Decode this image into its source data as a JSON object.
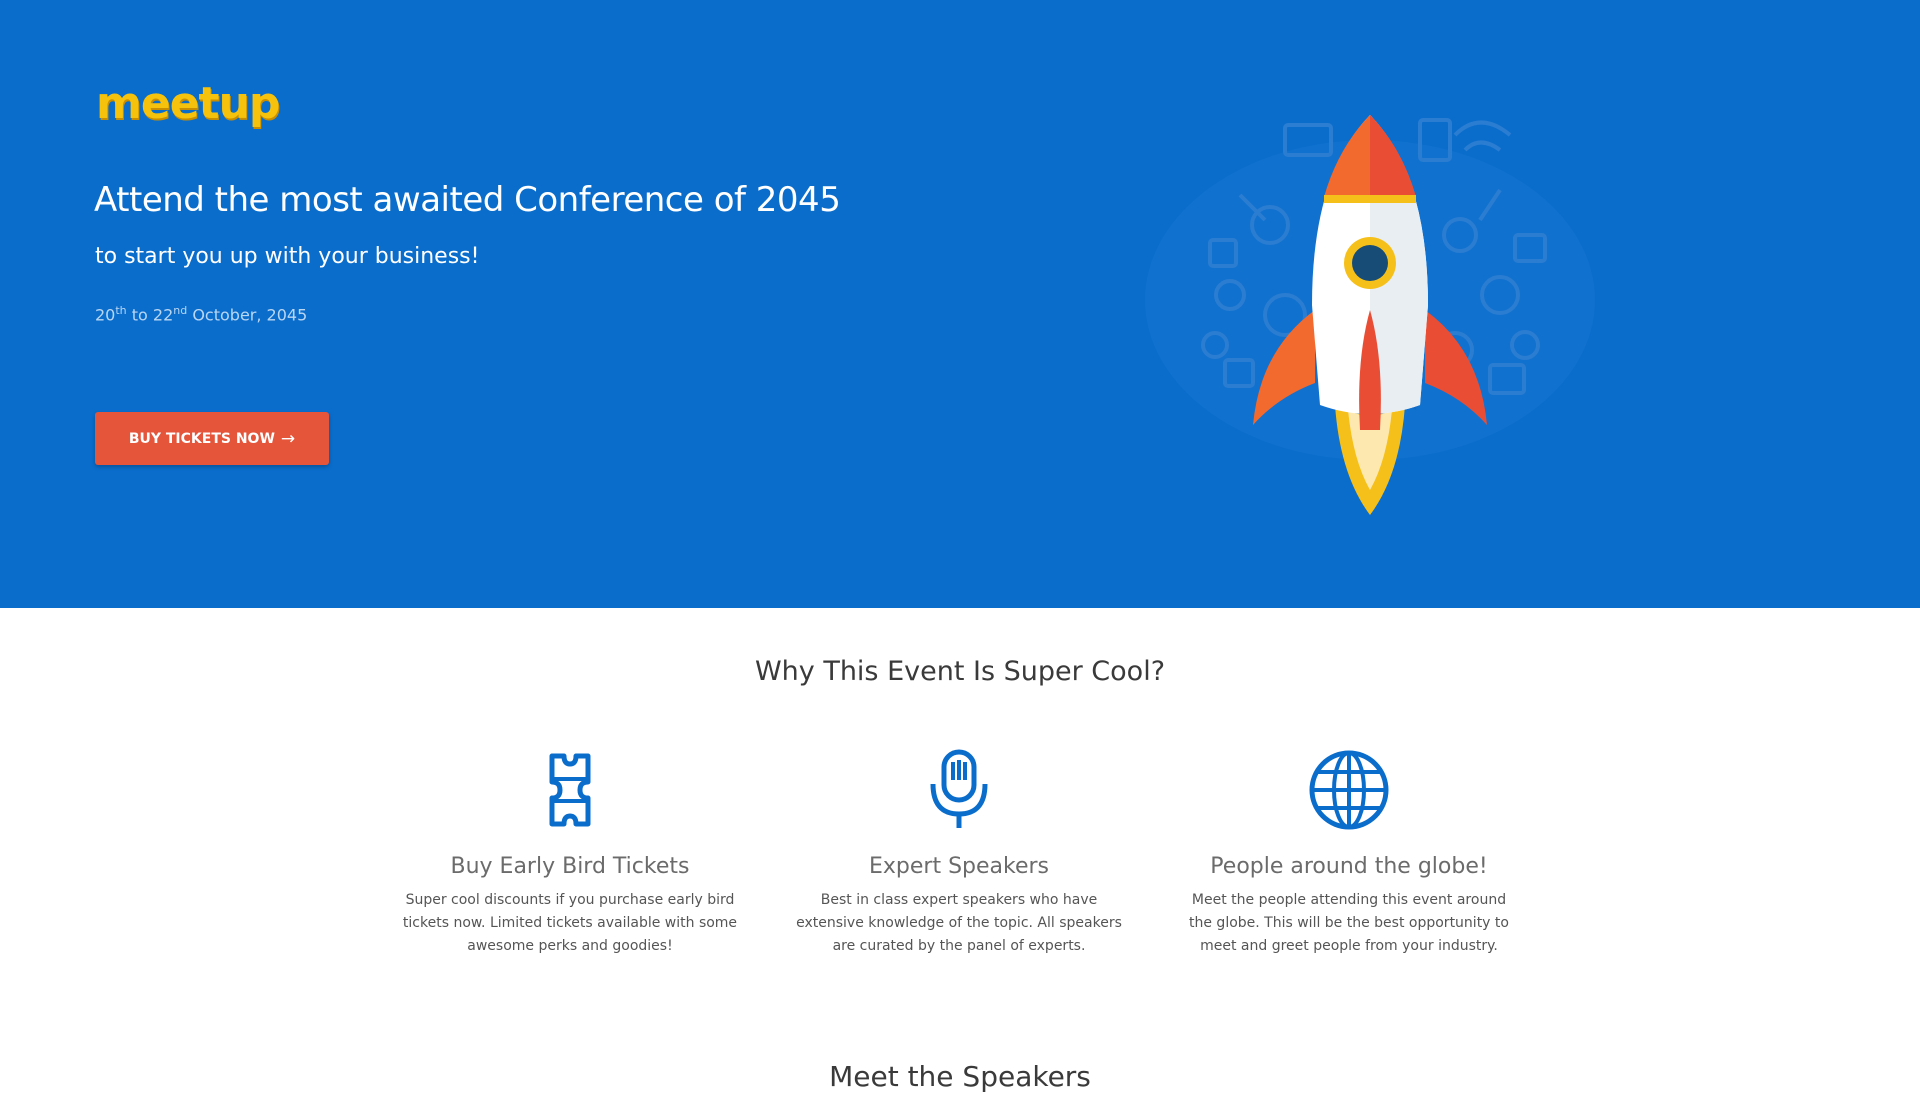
{
  "brand": {
    "logo_text": "meetup",
    "logo_color": "#f7c20b"
  },
  "hero": {
    "title": "Attend the most awaited Conference of 2045",
    "subtitle": "to start you up with your business!",
    "date": {
      "start_day": "20",
      "start_suffix": "th",
      "connector": "to",
      "end_day": "22",
      "end_suffix": "nd",
      "month_year": "October, 2045"
    },
    "cta_label": "BUY TICKETS NOW",
    "cta_icon": "arrow-right-icon",
    "background": "#0a6dcc",
    "cta_color": "#e4553a",
    "illustration": "rocket-launch-illustration"
  },
  "features": {
    "section_title": "Why This Event Is Super Cool?",
    "accent": "#0a6dcc",
    "items": [
      {
        "icon": "ticket-icon",
        "title": "Buy Early Bird Tickets",
        "text": "Super cool discounts if you purchase early bird tickets now. Limited tickets available with some awesome perks and goodies!"
      },
      {
        "icon": "microphone-icon",
        "title": "Expert Speakers",
        "text": "Best in class expert speakers who have extensive knowledge of the topic. All speakers are curated by the panel of experts."
      },
      {
        "icon": "globe-icon",
        "title": "People around the globe!",
        "text": "Meet the people attending this event around the globe. This will be the best opportunity to meet and greet people from your industry."
      }
    ]
  },
  "next_section": {
    "title": "Meet the Speakers"
  }
}
